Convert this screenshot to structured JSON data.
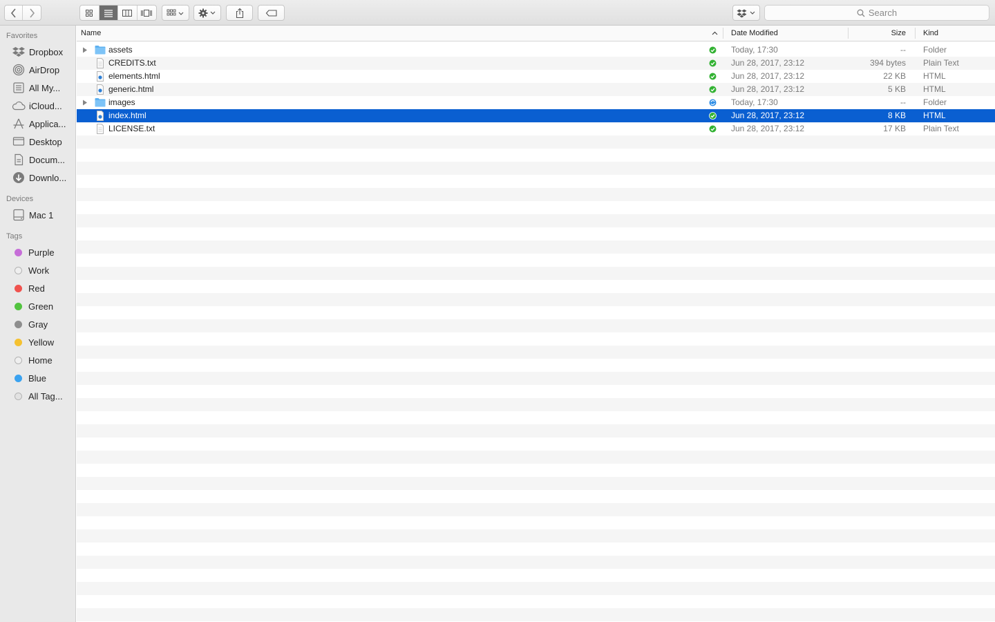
{
  "toolbar": {
    "search_placeholder": "Search",
    "view_modes": [
      "icon-view",
      "list-view",
      "column-view",
      "cover-flow-view"
    ],
    "active_view": "list-view"
  },
  "sidebar": {
    "favorites_header": "Favorites",
    "favorites": [
      {
        "label": "Dropbox",
        "icon": "dropbox-icon"
      },
      {
        "label": "AirDrop",
        "icon": "airdrop-icon"
      },
      {
        "label": "All My...",
        "icon": "all-my-files-icon"
      },
      {
        "label": "iCloud...",
        "icon": "icloud-icon"
      },
      {
        "label": "Applica...",
        "icon": "applications-icon"
      },
      {
        "label": "Desktop",
        "icon": "desktop-icon"
      },
      {
        "label": "Docum...",
        "icon": "documents-icon"
      },
      {
        "label": "Downlo...",
        "icon": "downloads-icon"
      }
    ],
    "devices_header": "Devices",
    "devices": [
      {
        "label": "Mac 1",
        "icon": "hard-drive-icon"
      }
    ],
    "tags_header": "Tags",
    "tags": [
      {
        "label": "Purple",
        "color": "#c66ed8"
      },
      {
        "label": "Work",
        "color": "none"
      },
      {
        "label": "Red",
        "color": "#f0524e"
      },
      {
        "label": "Green",
        "color": "#52c33f"
      },
      {
        "label": "Gray",
        "color": "#8e8e8e"
      },
      {
        "label": "Yellow",
        "color": "#f5c130"
      },
      {
        "label": "Home",
        "color": "none"
      },
      {
        "label": "Blue",
        "color": "#3aa2f0"
      },
      {
        "label": "All Tag...",
        "color": "all"
      }
    ]
  },
  "list": {
    "columns": {
      "name": "Name",
      "date": "Date Modified",
      "size": "Size",
      "kind": "Kind"
    },
    "sort_column": "Name",
    "selection_color": "#0a5fd1",
    "files": [
      {
        "name": "assets",
        "date": "Today, 17:30",
        "size": "--",
        "kind": "Folder",
        "type": "folder",
        "sync": "synced",
        "selected": false
      },
      {
        "name": "CREDITS.txt",
        "date": "Jun 28, 2017, 23:12",
        "size": "394 bytes",
        "kind": "Plain Text",
        "type": "text",
        "sync": "synced",
        "selected": false
      },
      {
        "name": "elements.html",
        "date": "Jun 28, 2017, 23:12",
        "size": "22 KB",
        "kind": "HTML",
        "type": "html",
        "sync": "synced",
        "selected": false
      },
      {
        "name": "generic.html",
        "date": "Jun 28, 2017, 23:12",
        "size": "5 KB",
        "kind": "HTML",
        "type": "html",
        "sync": "synced",
        "selected": false
      },
      {
        "name": "images",
        "date": "Today, 17:30",
        "size": "--",
        "kind": "Folder",
        "type": "folder",
        "sync": "syncing",
        "selected": false
      },
      {
        "name": "index.html",
        "date": "Jun 28, 2017, 23:12",
        "size": "8 KB",
        "kind": "HTML",
        "type": "html",
        "sync": "synced",
        "selected": true
      },
      {
        "name": "LICENSE.txt",
        "date": "Jun 28, 2017, 23:12",
        "size": "17 KB",
        "kind": "Plain Text",
        "type": "text",
        "sync": "synced",
        "selected": false
      }
    ]
  }
}
